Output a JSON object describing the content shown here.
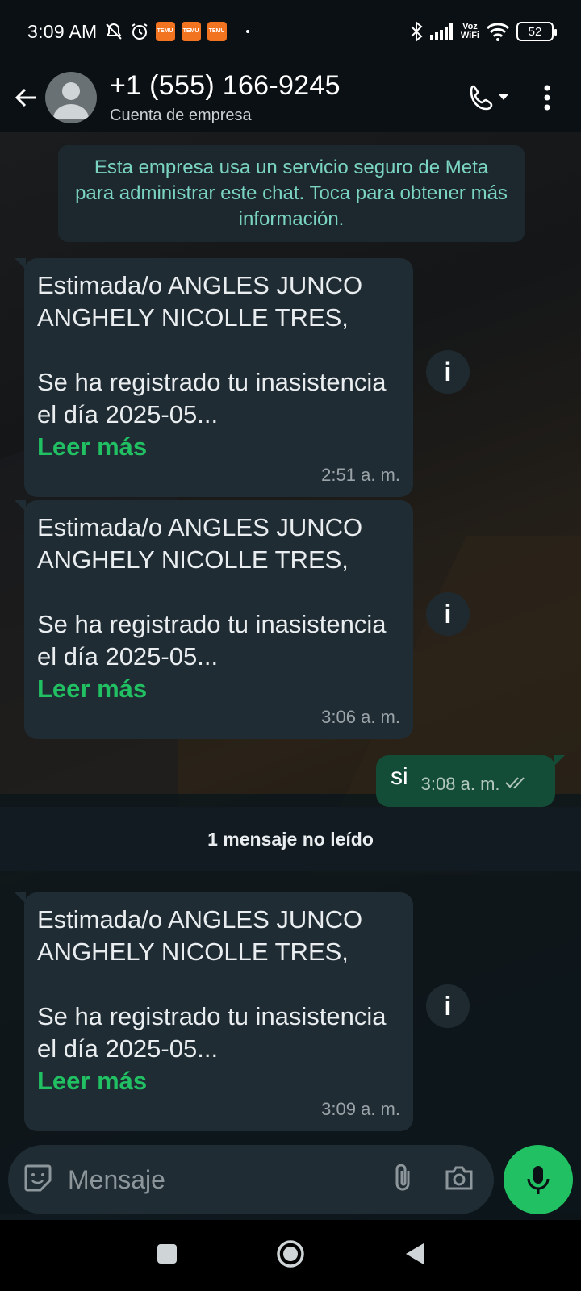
{
  "status_bar": {
    "time": "3:09 AM",
    "temu_label": "TEMU",
    "voz_wifi_top": "Voz",
    "voz_wifi_bottom": "WiFi",
    "battery": "52"
  },
  "header": {
    "contact_name": "+1 (555) 166-9245",
    "contact_subtitle": "Cuenta de empresa"
  },
  "system_notice": "Esta empresa usa un servicio seguro de Meta para administrar este chat. Toca para obtener más información.",
  "messages": [
    {
      "text": "Estimada/o ANGLES JUNCO ANGHELY NICOLLE TRES,\n\nSe ha registrado tu inasistencia el día 2025-05...",
      "read_more": "Leer más",
      "time": "2:51 a. m."
    },
    {
      "text": "Estimada/o ANGLES JUNCO ANGHELY NICOLLE TRES,\n\nSe ha registrado tu inasistencia el día 2025-05...",
      "read_more": "Leer más",
      "time": "3:06 a. m."
    },
    {
      "text": "Estimada/o ANGLES JUNCO ANGHELY NICOLLE TRES,\n\nSe ha registrado tu inasistencia el día 2025-05...",
      "read_more": "Leer más",
      "time": "3:09 a. m."
    }
  ],
  "outgoing": {
    "text": "si",
    "time": "3:08 a. m."
  },
  "unread_banner": "1 mensaje no leído",
  "composer": {
    "placeholder": "Mensaje"
  },
  "info_icon_glyph": "i",
  "colors": {
    "accent_green": "#21c063",
    "outgoing_bubble": "#134d37",
    "incoming_bubble": "#202c33",
    "notice_text": "#7ad4c1"
  }
}
